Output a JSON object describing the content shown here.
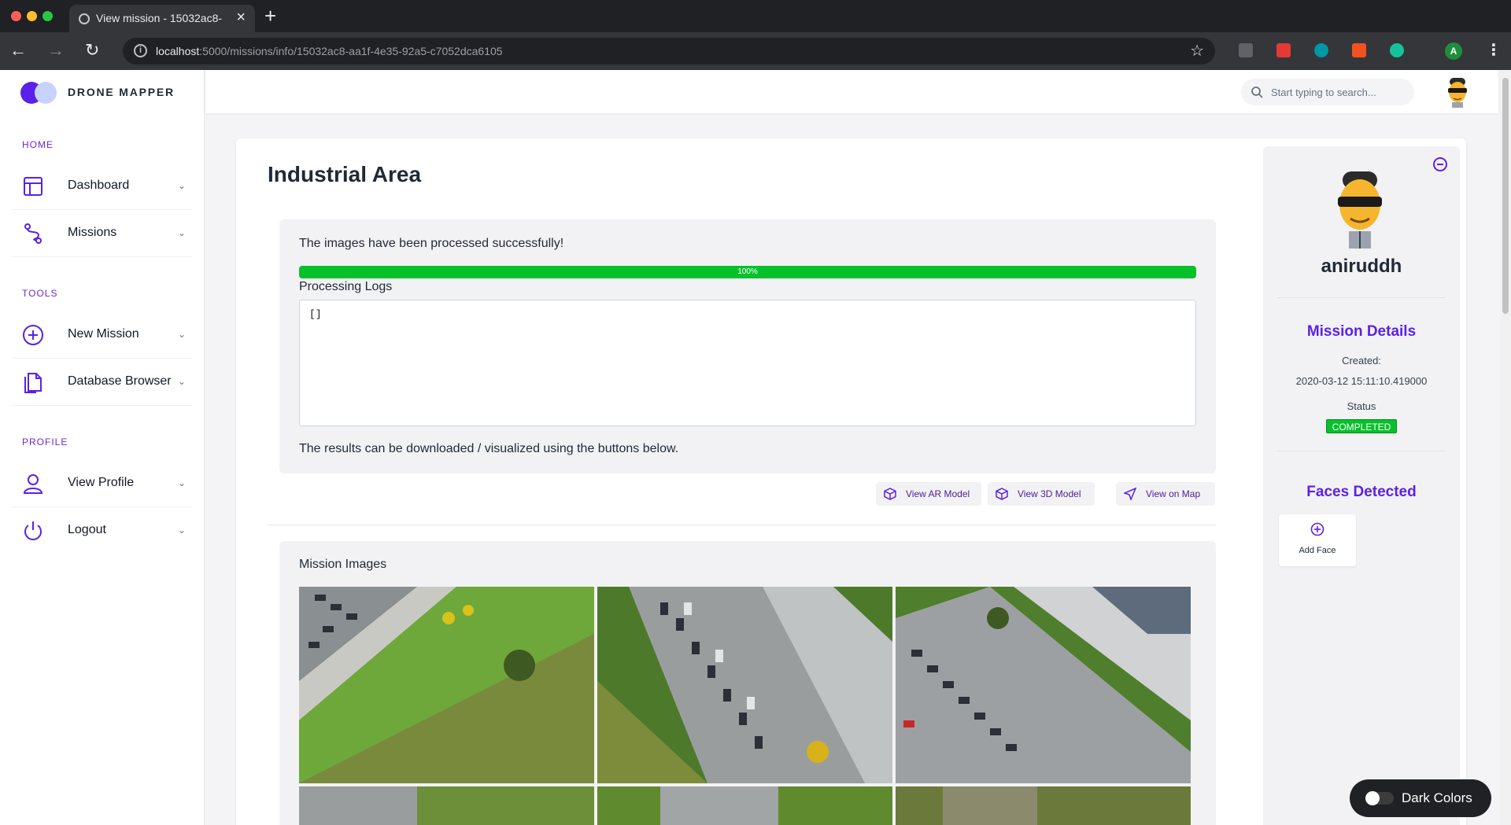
{
  "browser": {
    "tab_title": "View mission - 15032ac8-aa1f-4e35-92a5-c7052dca6105",
    "url_host": "localhost",
    "url_rest": ":5000/missions/info/15032ac8-aa1f-4e35-92a5-c7052dca6105",
    "profile_initial": "A"
  },
  "brand": {
    "name": "DRONE MAPPER"
  },
  "sidebar": {
    "sections": [
      {
        "title": "HOME"
      },
      {
        "title": "TOOLS"
      },
      {
        "title": "PROFILE"
      }
    ],
    "items": [
      {
        "label": "Dashboard",
        "icon": "dashboard-icon"
      },
      {
        "label": "Missions",
        "icon": "route-icon"
      },
      {
        "label": "New Mission",
        "icon": "plus-circle-icon"
      },
      {
        "label": "Database Browser",
        "icon": "files-icon"
      },
      {
        "label": "View Profile",
        "icon": "user-icon"
      },
      {
        "label": "Logout",
        "icon": "power-icon"
      }
    ]
  },
  "header": {
    "search_placeholder": "Start typing to search..."
  },
  "main": {
    "title": "Industrial Area",
    "status_message": "The images have been processed successfully!",
    "progress": {
      "value": 100,
      "label": "100%"
    },
    "logs_label": "Processing Logs",
    "logs_value": "[]",
    "results_message": "The results can be downloaded / visualized using the buttons below.",
    "actions": [
      {
        "label": "View AR Model",
        "icon": "cube-icon"
      },
      {
        "label": "View 3D Model",
        "icon": "cube-icon"
      },
      {
        "label": "View on Map",
        "icon": "navigation-icon"
      }
    ],
    "images_label": "Mission Images"
  },
  "profile_panel": {
    "username": "aniruddh",
    "mission_details_title": "Mission Details",
    "created_label": "Created:",
    "created_value": "2020-03-12 15:11:10.419000",
    "status_label": "Status",
    "status_value": "COMPLETED",
    "faces_title": "Faces Detected",
    "add_face_label": "Add Face"
  },
  "dark_toggle": {
    "label": "Dark Colors"
  },
  "colors": {
    "accent": "#5b21e6",
    "success": "#06c12a",
    "chrome_dark": "#202124"
  }
}
